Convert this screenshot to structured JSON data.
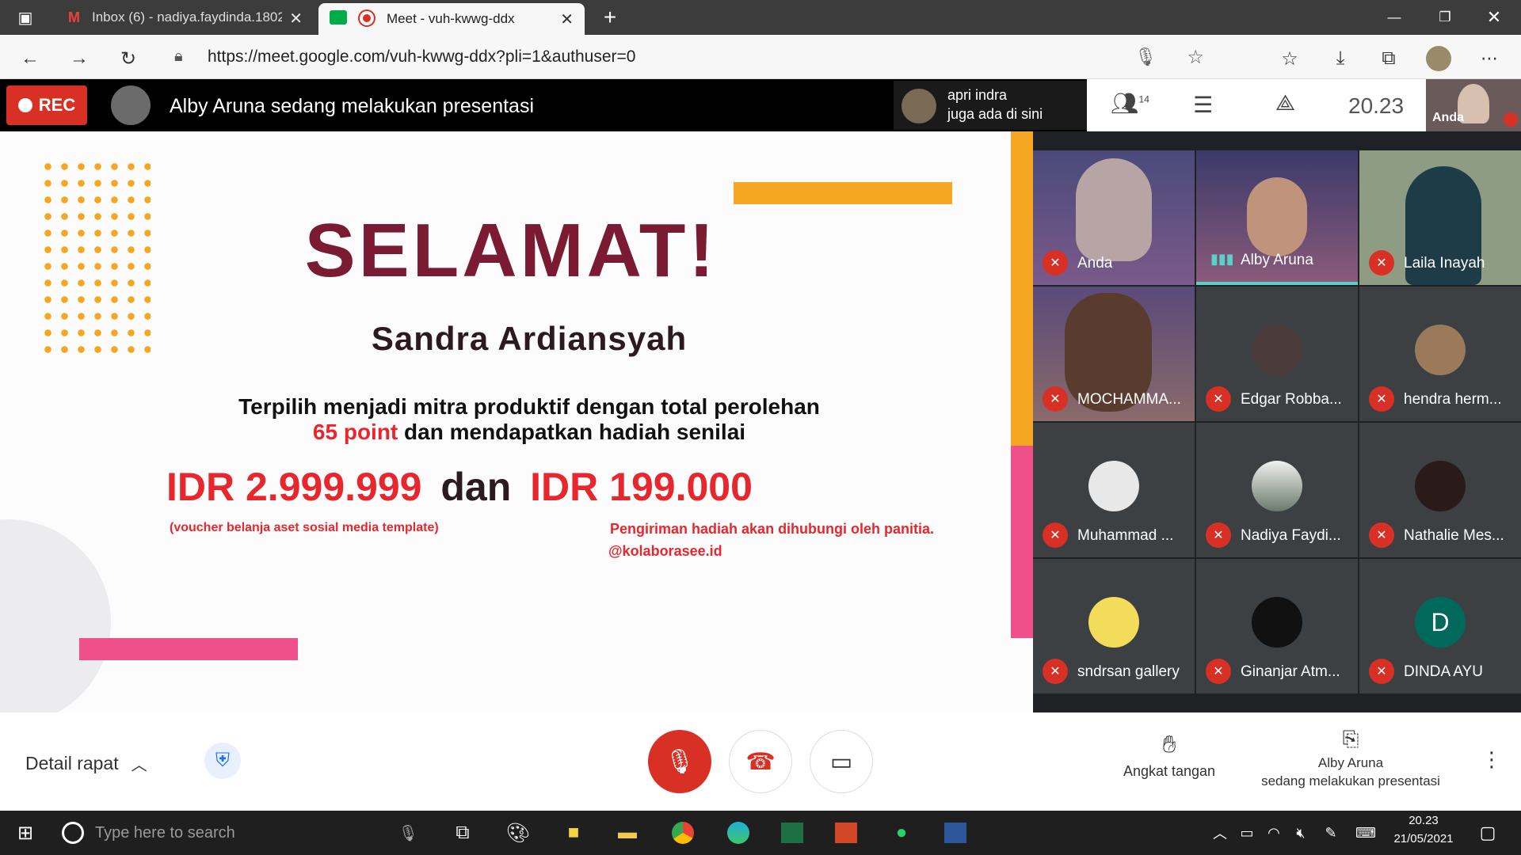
{
  "browser": {
    "tabs": [
      {
        "title": "Inbox (6) - nadiya.faydinda.1802",
        "active": false
      },
      {
        "title": "Meet - vuh-kwwg-ddx",
        "active": true
      }
    ],
    "url": "https://meet.google.com/vuh-kwwg-ddx?pli=1&authuser=0",
    "new_tab": "+"
  },
  "meet_top": {
    "rec": "REC",
    "presenting": "Alby Aruna sedang melakukan presentasi",
    "notify_name": "apri indra",
    "notify_text": "juga ada di sini",
    "participants_count": "14",
    "time": "20.23",
    "self_label": "Anda"
  },
  "slide": {
    "title": "SELAMAT!",
    "name": "Sandra Ardiansyah",
    "line1": "Terpilih menjadi mitra produktif dengan total perolehan",
    "points": "65 point",
    "line2": "dan mendapatkan hadiah senilai",
    "prize1": "IDR 2.999.999",
    "and": "dan",
    "prize2": "IDR 199.000",
    "note1": "(voucher belanja aset sosial media template)",
    "note2": "Pengiriman hadiah akan dihubungi oleh panitia.",
    "handle": "@kolaborasee.id"
  },
  "participants": [
    "Anda",
    "Alby Aruna",
    "Laila Inayah",
    "MOCHAMMA...",
    "Edgar Robba...",
    "hendra herm...",
    "Muhammad ...",
    "Nadiya Faydi...",
    "Nathalie Mes...",
    "sndrsan gallery",
    "Ginanjar Atm...",
    "DINDA AYU"
  ],
  "dinda_initial": "D",
  "bottom": {
    "details": "Detail rapat",
    "raise_hand": "Angkat tangan",
    "present_name": "Alby Aruna",
    "present_text": "sedang melakukan presentasi"
  },
  "taskbar": {
    "search_placeholder": "Type here to search",
    "time": "20.23",
    "date": "21/05/2021"
  },
  "colors": {
    "maroon": "#7a1a33",
    "red": "#e8262d",
    "rec": "#d93025",
    "orange": "#f5a623",
    "pink": "#f0508a"
  }
}
